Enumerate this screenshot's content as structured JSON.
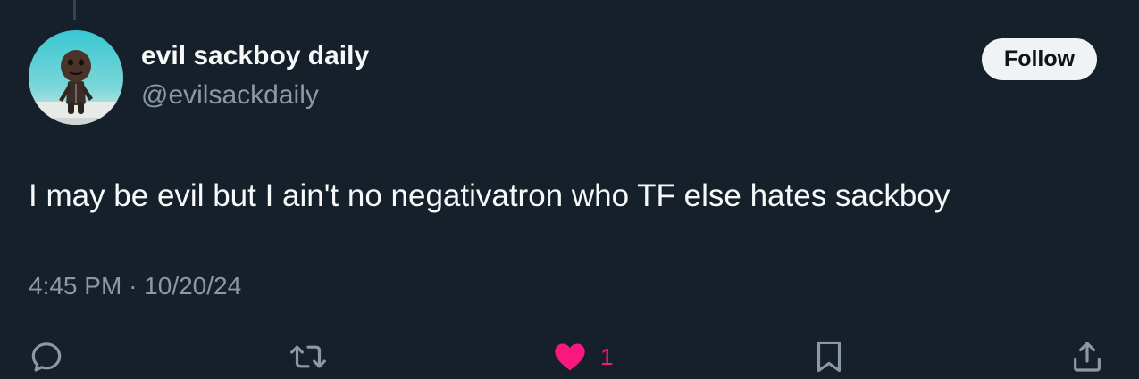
{
  "user": {
    "display_name": "evil sackboy daily",
    "handle": "@evilsackdaily"
  },
  "follow_button": {
    "label": "Follow"
  },
  "tweet": {
    "text": "I may be evil but I ain't no negativatron who TF else hates sackboy",
    "time": "4:45 PM",
    "separator": "·",
    "date": "10/20/24"
  },
  "actions": {
    "reply": {
      "icon": "reply-icon"
    },
    "retweet": {
      "icon": "retweet-icon"
    },
    "like": {
      "icon": "heart-icon",
      "count": "1",
      "liked": true,
      "color": "#f91880"
    },
    "bookmark": {
      "icon": "bookmark-icon"
    },
    "share": {
      "icon": "share-icon"
    }
  },
  "theme": {
    "background": "#15202b",
    "text_primary": "#f7f9f9",
    "text_secondary": "#8b98a5",
    "accent_like": "#f91880"
  }
}
